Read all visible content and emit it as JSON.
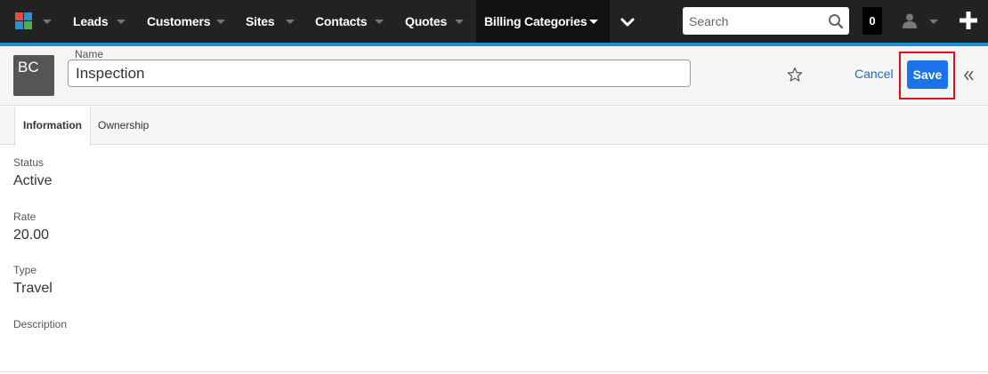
{
  "topnav": {
    "items": [
      {
        "label": "Leads"
      },
      {
        "label": "Customers"
      },
      {
        "label": "Sites"
      },
      {
        "label": "Contacts"
      },
      {
        "label": "Quotes"
      },
      {
        "label": "Billing Categories"
      }
    ],
    "search_placeholder": "Search",
    "notification_count": "0",
    "accent_color": "#1a8fd6",
    "icons": [
      "app-logo-icon",
      "chevron-down-icon",
      "search-icon",
      "user-icon",
      "plus-icon"
    ]
  },
  "record": {
    "module_abbr": "BC",
    "name_label": "Name",
    "name_value": "Inspection",
    "cancel_label": "Cancel",
    "save_label": "Save",
    "save_color": "#1a73e8",
    "icons": [
      "star-icon",
      "double-chevron-left-icon"
    ]
  },
  "tabs": [
    {
      "label": "Information",
      "active": true
    },
    {
      "label": "Ownership",
      "active": false
    }
  ],
  "fields": [
    {
      "label": "Status",
      "value": "Active"
    },
    {
      "label": "Rate",
      "value": "20.00"
    },
    {
      "label": "Type",
      "value": "Travel"
    },
    {
      "label": "Description",
      "value": ""
    }
  ]
}
